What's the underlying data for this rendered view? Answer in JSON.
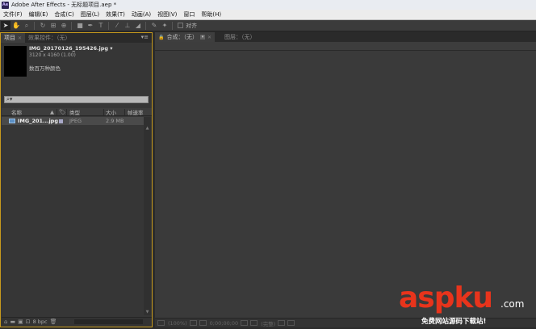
{
  "window": {
    "app_icon_text": "Ae",
    "title": "Adobe After Effects - 无标题项目.aep *"
  },
  "menu": [
    "文件(F)",
    "编辑(E)",
    "合成(C)",
    "图层(L)",
    "效果(T)",
    "动画(A)",
    "视图(V)",
    "窗口",
    "帮助(H)"
  ],
  "toolbar": {
    "snap_label": "对齐"
  },
  "project_panel": {
    "tab_project": "项目",
    "tab_effects": "效果控件：（无）",
    "menu_glyph": "▾≡",
    "selected_file": {
      "name": "IMG_20170126_195426.jpg ▾",
      "dimensions": "3120 x 4160 (1.00)",
      "colors": "数百万种颜色"
    },
    "search_glyph": "⌕▾",
    "columns": {
      "name": "名称",
      "label_icon": "🏷",
      "type": "类型",
      "size": "大小",
      "framerate": "帧速率"
    },
    "items": [
      {
        "name": "IMG_201...jpg",
        "type": "JPEG",
        "size": "2.9 MB"
      }
    ],
    "footer": {
      "bpc": "8 bpc"
    }
  },
  "comp_panel": {
    "tab_comp": "合成：（无）",
    "tab_layer": "图层：（无）",
    "bottom": {
      "zoom": "(100%)",
      "timecode": "0;00;00;00",
      "res": "(完整)"
    }
  },
  "watermark": {
    "logo": "aspku",
    "domain": ".com",
    "slogan": "免费网站源码下载站!"
  }
}
